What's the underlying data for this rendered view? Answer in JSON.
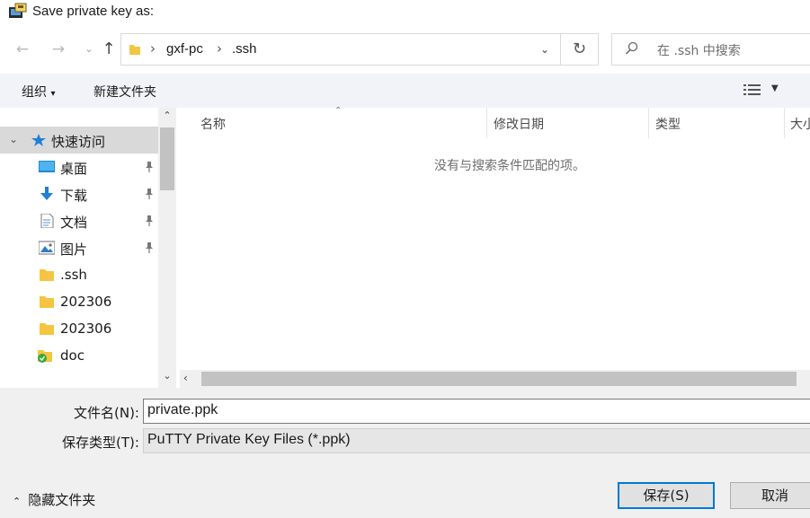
{
  "window": {
    "title": "Save private key as:"
  },
  "nav": {
    "back_icon": "arrow-left-icon",
    "forward_icon": "arrow-right-icon",
    "history_icon": "chevron-down-icon",
    "up_icon": "arrow-up-icon"
  },
  "address": {
    "crumbs": [
      "gxf-pc",
      ".ssh"
    ],
    "separator": "›"
  },
  "search": {
    "placeholder": "在 .ssh 中搜索"
  },
  "toolbar": {
    "organize_label": "组织",
    "new_folder_label": "新建文件夹"
  },
  "sidebar": {
    "items": [
      {
        "label": "快速访问",
        "icon": "star-icon"
      },
      {
        "label": "桌面",
        "icon": "desktop-icon",
        "pinned": true
      },
      {
        "label": "下载",
        "icon": "download-icon",
        "pinned": true
      },
      {
        "label": "文档",
        "icon": "document-icon",
        "pinned": true
      },
      {
        "label": "图片",
        "icon": "picture-icon",
        "pinned": true
      },
      {
        "label": ".ssh",
        "icon": "folder-icon"
      },
      {
        "label": "202306",
        "icon": "folder-icon"
      },
      {
        "label": "202306",
        "icon": "folder-icon"
      },
      {
        "label": "doc",
        "icon": "folder-synced-icon"
      }
    ]
  },
  "columns": [
    "名称",
    "修改日期",
    "类型",
    "大小"
  ],
  "empty_message": "没有与搜索条件匹配的项。",
  "form": {
    "filename_label": "文件名(N):",
    "filename_value": "private.ppk",
    "filetype_label": "保存类型(T):",
    "filetype_value": "PuTTY Private Key Files (*.ppk)"
  },
  "footer": {
    "hide_folders_label": "隐藏文件夹",
    "save_label": "保存(S)",
    "cancel_label": "取消"
  },
  "colors": {
    "accent": "#0078d7",
    "folder": "#f4c542",
    "selected_bg": "#d9d9d9"
  }
}
